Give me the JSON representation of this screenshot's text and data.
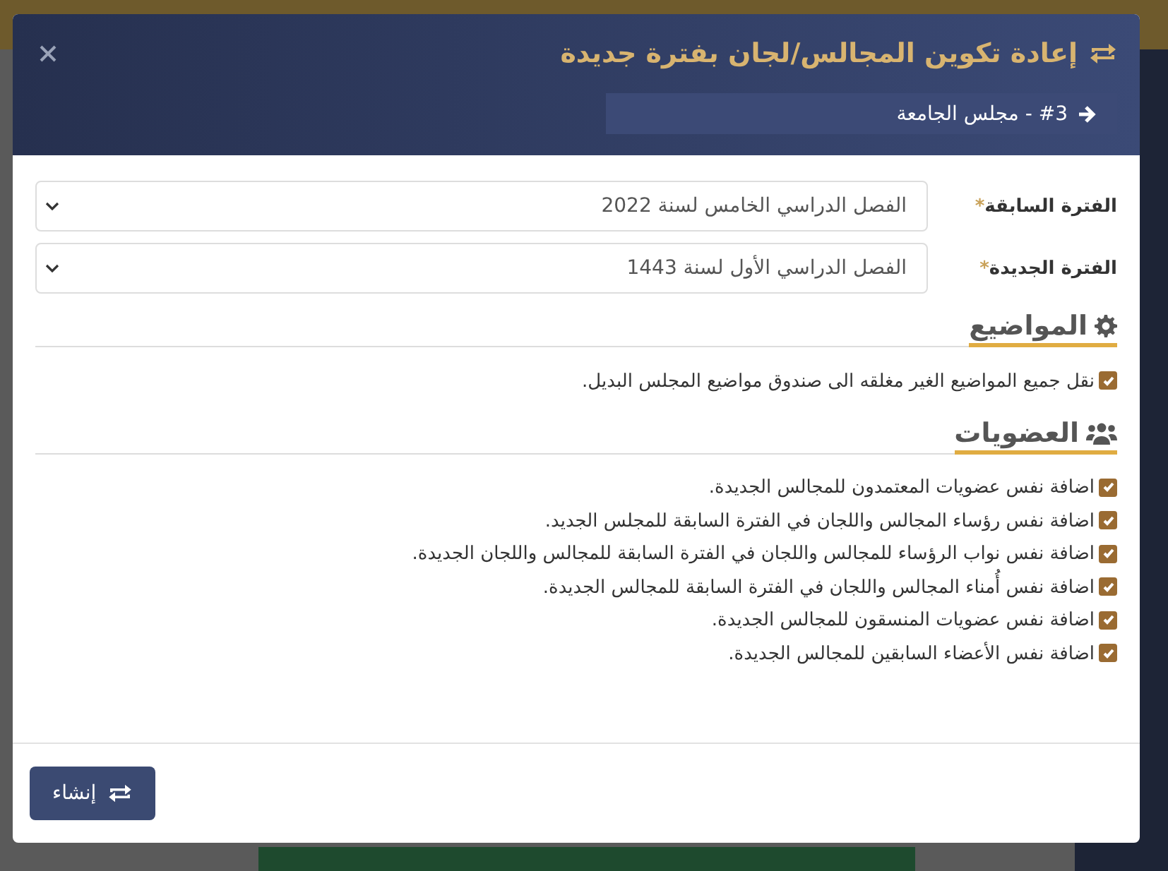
{
  "modal": {
    "title": "إعادة تكوين المجالس/لجان بفترة جديدة",
    "subtitle": "#3 - مجلس الجامعة"
  },
  "fields": [
    {
      "label": "الفترة السابقة",
      "required_mark": "*",
      "value": "الفصل الدراسي الخامس لسنة 2022"
    },
    {
      "label": "الفترة الجديدة",
      "required_mark": "*",
      "value": "الفصل الدراسي الأول لسنة 1443"
    }
  ],
  "sections": [
    {
      "kind": "topics",
      "heading": "المواضيع",
      "options": [
        {
          "label": "نقل جميع المواضيع الغير مغلقه الى صندوق مواضيع المجلس البديل.",
          "checked": true
        }
      ]
    },
    {
      "kind": "members",
      "heading": "العضويات",
      "options": [
        {
          "label": "اضافة نفس عضويات المعتمدون للمجالس الجديدة.",
          "checked": true
        },
        {
          "label": "اضافة نفس رؤساء المجالس واللجان في الفترة السابقة للمجلس الجديد.",
          "checked": true
        },
        {
          "label": "اضافة نفس نواب الرؤساء للمجالس واللجان في الفترة السابقة للمجالس واللجان الجديدة.",
          "checked": true
        },
        {
          "label": "اضافة نفس أُمناء المجالس واللجان في الفترة السابقة للمجالس الجديدة.",
          "checked": true
        },
        {
          "label": "اضافة نفس عضويات المنسقون للمجالس الجديدة.",
          "checked": true
        },
        {
          "label": "اضافة نفس الأعضاء السابقين للمجالس الجديدة.",
          "checked": true
        }
      ]
    }
  ],
  "footer": {
    "button": "إنشاء"
  }
}
